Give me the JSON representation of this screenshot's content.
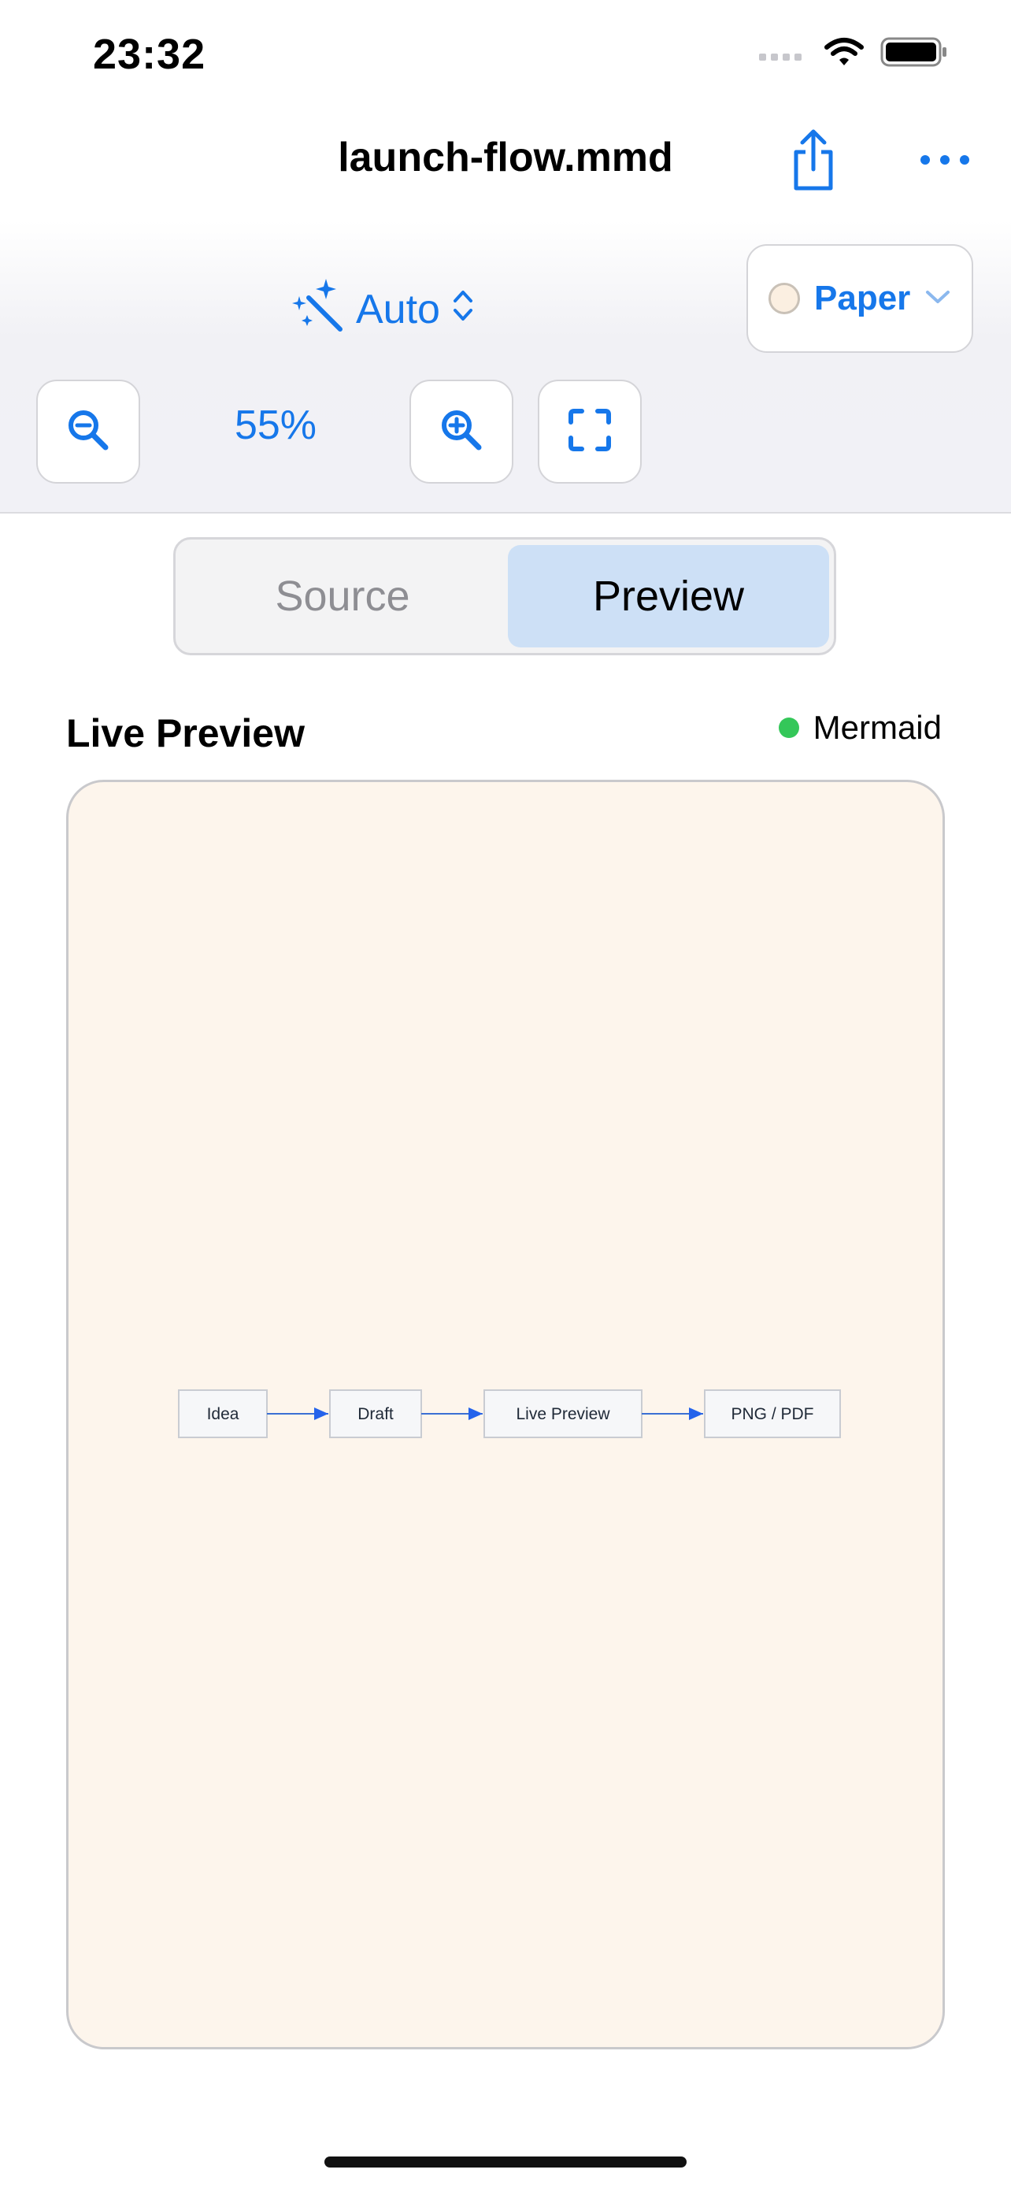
{
  "status_bar": {
    "time": "23:32"
  },
  "nav": {
    "title": "launch-flow.mmd"
  },
  "toolbar": {
    "mode_label": "Auto",
    "theme_label": "Paper",
    "zoom_value": "55%"
  },
  "segmented_control": {
    "source_label": "Source",
    "preview_label": "Preview",
    "selected": "Preview"
  },
  "preview": {
    "title": "Live Preview",
    "engine": "Mermaid",
    "diagram": {
      "nodes": [
        "Idea",
        "Draft",
        "Live Preview",
        "PNG / PDF"
      ]
    }
  },
  "colors": {
    "accent": "#1677ea",
    "canvas_background": "#fdf5ec",
    "status_ok": "#34c759",
    "selected_segment": "#cde0f6"
  },
  "icons": {
    "share": "share-icon",
    "more": "ellipsis-icon",
    "mode": "magic-wand-icon",
    "zoom_out": "zoom-out-icon",
    "zoom_in": "zoom-in-icon",
    "fit": "fit-screen-icon"
  }
}
